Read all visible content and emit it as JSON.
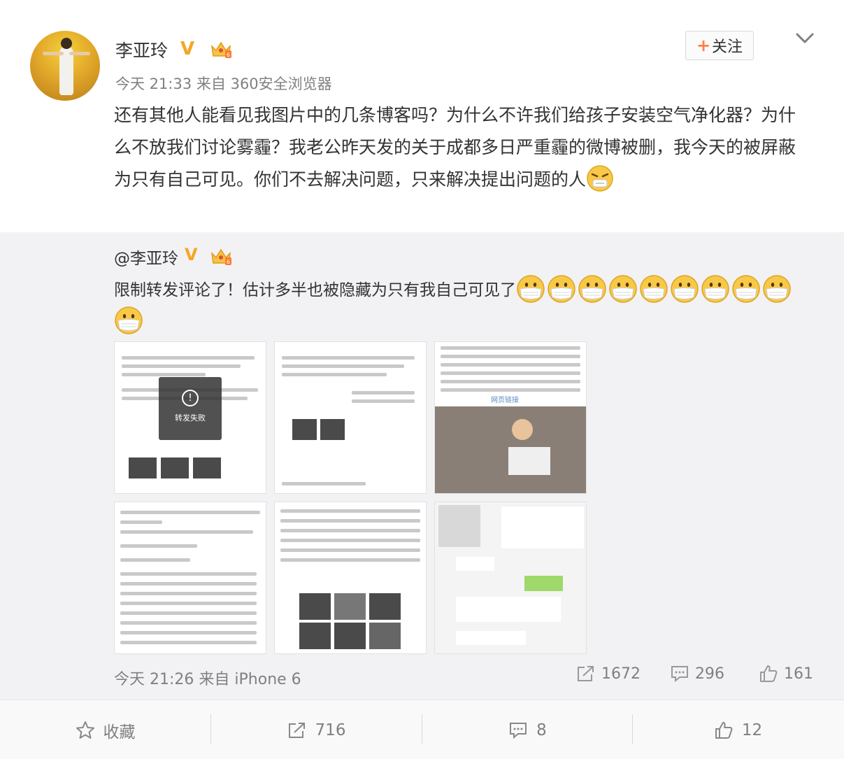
{
  "post": {
    "author": "李亚玲",
    "verified_badge": "V",
    "time": "今天 21:33",
    "source_prefix": "来自",
    "source": "360安全浏览器",
    "follow_label": "关注",
    "text": "还有其他人能看见我图片中的几条博客吗？为什么不许我们给孩子安装空气净化器？为什么不放我们讨论雾霾？我老公昨天发的关于成都多日严重霾的微博被删，我今天的被屏蔽为只有自己可见。你们不去解决问题，只来解决提出问题的人"
  },
  "repost": {
    "mention": "@李亚玲",
    "verified_badge": "V",
    "text": "限制转发评论了！估计多半也被隐藏为只有我自己可见了",
    "mask_emoji_count": 10,
    "thumbnails": [
      {
        "overlay": "转发失败"
      },
      {},
      {
        "link": "网页链接"
      },
      {},
      {},
      {}
    ],
    "time": "今天 21:26",
    "source_prefix": "来自",
    "source": "iPhone 6",
    "reposts": "1672",
    "comments": "296",
    "likes": "161"
  },
  "actions": {
    "favorite": "收藏",
    "repost": "716",
    "comment": "8",
    "like": "12"
  },
  "colors": {
    "accent_orange": "#ff8140",
    "verified_gold": "#f5a623",
    "meta_gray": "#808080",
    "repost_bg": "#f2f2f5"
  }
}
